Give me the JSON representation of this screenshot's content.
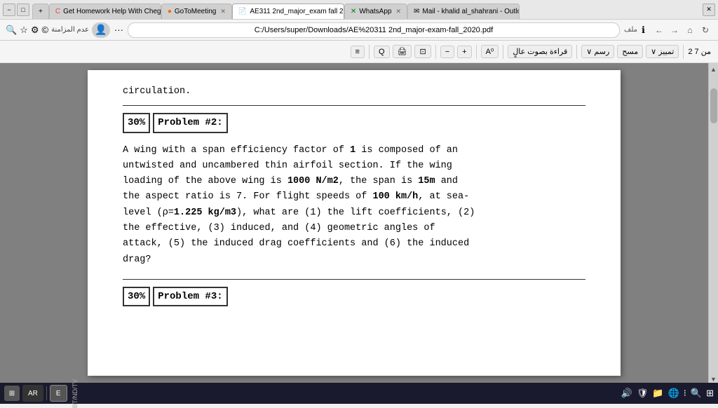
{
  "browser": {
    "title": "AE311 2nd major exam fall 2020.pdf",
    "tabs": [
      {
        "id": "tab-new",
        "label": "+",
        "active": false,
        "closable": false
      },
      {
        "id": "tab-homework",
        "label": "Get Homework Help With Cheg…",
        "active": false,
        "icon": "C",
        "closable": true
      },
      {
        "id": "tab-gotomeeting",
        "label": "GoToMeeting",
        "active": false,
        "icon": "G",
        "closable": true
      },
      {
        "id": "tab-pdf",
        "label": "AE311 2nd_major_exam fall 20…",
        "active": true,
        "icon": "📄",
        "closable": true
      },
      {
        "id": "tab-whatsapp",
        "label": "WhatsApp",
        "active": false,
        "icon": "W",
        "closable": true
      },
      {
        "id": "tab-mail",
        "label": "Mail - khalid al_shahrani - Outlo…",
        "active": false,
        "icon": "M",
        "closable": true
      }
    ],
    "address": "C:/Users/super/Downloads/AE%20311 2nd_major-exam-fall_2020.pdf",
    "address_label": "ملف",
    "nav": {
      "back": "←",
      "forward": "→",
      "reload": "↻",
      "home": "⌂"
    }
  },
  "toolbar": {
    "page_current": "2",
    "page_total": "7",
    "of_label": "من",
    "zoom_label": "تمييز",
    "draw_label": "رسم",
    "read_label": "قراءة بصوت عالٍ",
    "rotate_label": "A⁰",
    "add_label": "+",
    "subtract_label": "−",
    "search_label": "Q",
    "print_label": "🖨",
    "fit_label": "⊡",
    "erase_label": "مسح",
    "highlight_chevron": "∨",
    "draw_arrow": "∨"
  },
  "pdf": {
    "circulation_text": "circulation.",
    "divider1": true,
    "problem2": {
      "percent": "30%",
      "title": "Problem #2:",
      "body_lines": [
        "A wing with a span efficiency factor of 1 is composed of an",
        "untwisted and uncambered thin airfoil section. If the wing",
        "loading of the above wing is 1000 N/m2, the span is 15m and",
        "the aspect ratio is 7. For flight speeds of 100 km/h, at sea-",
        "level (ρ=1.225 kg/m3), what are (1) the lift coefficients, (2)",
        "the effective,  (3)  induced,  and  (4)  geometric angles of",
        "attack, (5) the induced drag coefficients and (6) the induced",
        "drag?"
      ]
    },
    "divider2": true,
    "problem3": {
      "percent": "30%",
      "title": "Problem #3:"
    }
  },
  "taskbar": {
    "start_icon": "⊞",
    "items": [
      {
        "label": "AR",
        "sublabel": "BT/ND/TV",
        "active": false
      },
      {
        "label": "E",
        "active": false
      }
    ],
    "right_icons": [
      "🔊",
      "🛡",
      "📁",
      "🌐",
      "⁝⁝",
      "🔍",
      "⊞"
    ]
  }
}
